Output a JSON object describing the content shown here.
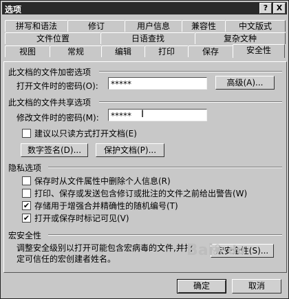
{
  "window": {
    "title": "选项",
    "help_btn": "?",
    "close_btn": "X"
  },
  "tabs_row1": [
    "拼写和语法",
    "修订",
    "用户信息",
    "兼容性",
    "中文版式"
  ],
  "tabs_row2": [
    "文件位置",
    "日语查找",
    "复杂文种"
  ],
  "tabs_row3": [
    "视图",
    "常规",
    "编辑",
    "打印",
    "保存",
    "安全性"
  ],
  "encryption": {
    "title": "此文档的文件加密选项",
    "open_label": "打开文件时的密码(O):",
    "open_value": "*****",
    "advanced_btn": "高级(A)..."
  },
  "sharing": {
    "title": "此文档的文件共享选项",
    "modify_label": "修改文件时的密码(M):",
    "modify_value": "*****",
    "readonly_label": "建议以只读方式打开文档(E)",
    "signature_btn": "数字签名(D)...",
    "protect_btn": "保护文档(P)..."
  },
  "privacy": {
    "title": "隐私选项",
    "options": [
      {
        "label": "保存时从文件属性中删除个人信息(R)",
        "checked": false
      },
      {
        "label": "打印、保存或发送包含修订或批注的文件之前给出警告(W)",
        "checked": false
      },
      {
        "label": "存储用于增强合并精确性的随机编号(T)",
        "checked": true
      },
      {
        "label": "打开或保存时标记可见(V)",
        "checked": true
      }
    ]
  },
  "macro": {
    "title": "宏安全性",
    "desc_line1": "调整安全级别以打开可能包含宏病毒的文件,并指",
    "desc_line2": "定可信任的宏创建者姓名。",
    "btn": "宏安全性(S)..."
  },
  "footer": {
    "ok": "确定",
    "cancel": "取消"
  }
}
